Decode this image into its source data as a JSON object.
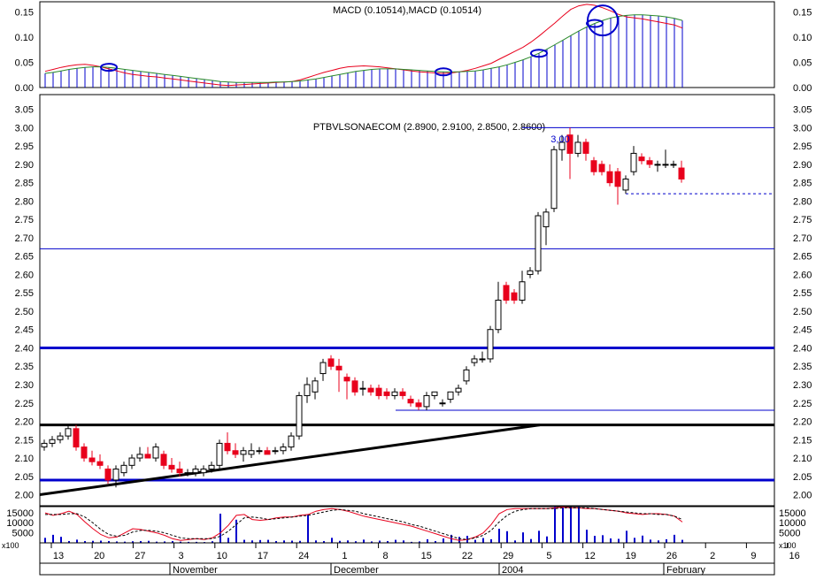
{
  "colors": {
    "background": "#ffffff",
    "up_candle_fill": "#ffffff",
    "down_candle_fill": "#e8001c",
    "blue": "#0000cc",
    "macd_line": "#e8001c",
    "signal_line": "#2a8a2a",
    "black": "#000000",
    "grid_line": "#000000"
  },
  "macd_panel": {
    "title": "MACD (0.10514),MACD (0.10514)",
    "y_ticks": [
      "0.15",
      "0.10",
      "0.05",
      "0.00"
    ]
  },
  "price_panel": {
    "title": "PTBVLSONAECOM (2.8900, 2.9100, 2.8500, 2.8600)",
    "y_ticks": [
      "3.05",
      "3.00",
      "2.95",
      "2.90",
      "2.85",
      "2.80",
      "2.75",
      "2.70",
      "2.65",
      "2.60",
      "2.55",
      "2.50",
      "2.45",
      "2.40",
      "2.35",
      "2.30",
      "2.25",
      "2.20",
      "2.15",
      "2.10",
      "2.05",
      "2.00"
    ],
    "annotation_label": "3,00"
  },
  "volume_panel": {
    "y_ticks": [
      "15000",
      "10000",
      "5000"
    ],
    "multiplier_label": "x100"
  },
  "x_axis": {
    "day_ticks": [
      "13",
      "20",
      "27",
      "3",
      "10",
      "17",
      "24",
      "1",
      "8",
      "15",
      "22",
      "29",
      "5",
      "12",
      "19",
      "26",
      "2",
      "9",
      "16"
    ],
    "month_labels": [
      "November",
      "December",
      "2004",
      "February"
    ]
  },
  "chart_data": {
    "type": "candlestick",
    "title": "PTBVLSONAECOM (2.8900, 2.9100, 2.8500, 2.8600)",
    "xlabel": "",
    "ylabel": "",
    "ylim": [
      1.97,
      3.09
    ],
    "candles": [
      {
        "o": 2.13,
        "h": 2.15,
        "l": 2.12,
        "c": 2.14
      },
      {
        "o": 2.14,
        "h": 2.16,
        "l": 2.13,
        "c": 2.15
      },
      {
        "o": 2.15,
        "h": 2.17,
        "l": 2.14,
        "c": 2.16
      },
      {
        "o": 2.16,
        "h": 2.19,
        "l": 2.15,
        "c": 2.18
      },
      {
        "o": 2.18,
        "h": 2.19,
        "l": 2.12,
        "c": 2.13
      },
      {
        "o": 2.13,
        "h": 2.14,
        "l": 2.09,
        "c": 2.1
      },
      {
        "o": 2.1,
        "h": 2.12,
        "l": 2.08,
        "c": 2.09
      },
      {
        "o": 2.09,
        "h": 2.11,
        "l": 2.07,
        "c": 2.08
      },
      {
        "o": 2.07,
        "h": 2.08,
        "l": 2.03,
        "c": 2.04
      },
      {
        "o": 2.04,
        "h": 2.08,
        "l": 2.02,
        "c": 2.07
      },
      {
        "o": 2.06,
        "h": 2.09,
        "l": 2.05,
        "c": 2.08
      },
      {
        "o": 2.08,
        "h": 2.11,
        "l": 2.07,
        "c": 2.1
      },
      {
        "o": 2.1,
        "h": 2.13,
        "l": 2.09,
        "c": 2.11
      },
      {
        "o": 2.11,
        "h": 2.13,
        "l": 2.1,
        "c": 2.1
      },
      {
        "o": 2.1,
        "h": 2.14,
        "l": 2.09,
        "c": 2.13
      },
      {
        "o": 2.11,
        "h": 2.12,
        "l": 2.07,
        "c": 2.08
      },
      {
        "o": 2.08,
        "h": 2.1,
        "l": 2.06,
        "c": 2.07
      },
      {
        "o": 2.07,
        "h": 2.09,
        "l": 2.05,
        "c": 2.06
      },
      {
        "o": 2.06,
        "h": 2.07,
        "l": 2.05,
        "c": 2.06
      },
      {
        "o": 2.06,
        "h": 2.08,
        "l": 2.05,
        "c": 2.07
      },
      {
        "o": 2.06,
        "h": 2.08,
        "l": 2.05,
        "c": 2.07
      },
      {
        "o": 2.07,
        "h": 2.09,
        "l": 2.06,
        "c": 2.08
      },
      {
        "o": 2.08,
        "h": 2.15,
        "l": 2.07,
        "c": 2.14
      },
      {
        "o": 2.14,
        "h": 2.17,
        "l": 2.11,
        "c": 2.12
      },
      {
        "o": 2.12,
        "h": 2.14,
        "l": 2.1,
        "c": 2.11
      },
      {
        "o": 2.11,
        "h": 2.13,
        "l": 2.09,
        "c": 2.12
      },
      {
        "o": 2.11,
        "h": 2.14,
        "l": 2.1,
        "c": 2.12
      },
      {
        "o": 2.12,
        "h": 2.13,
        "l": 2.11,
        "c": 2.12
      },
      {
        "o": 2.12,
        "h": 2.13,
        "l": 2.11,
        "c": 2.11
      },
      {
        "o": 2.12,
        "h": 2.13,
        "l": 2.11,
        "c": 2.12
      },
      {
        "o": 2.12,
        "h": 2.14,
        "l": 2.11,
        "c": 2.13
      },
      {
        "o": 2.13,
        "h": 2.17,
        "l": 2.12,
        "c": 2.16
      },
      {
        "o": 2.16,
        "h": 2.28,
        "l": 2.15,
        "c": 2.27
      },
      {
        "o": 2.27,
        "h": 2.32,
        "l": 2.25,
        "c": 2.3
      },
      {
        "o": 2.28,
        "h": 2.32,
        "l": 2.26,
        "c": 2.31
      },
      {
        "o": 2.33,
        "h": 2.37,
        "l": 2.31,
        "c": 2.36
      },
      {
        "o": 2.37,
        "h": 2.38,
        "l": 2.34,
        "c": 2.35
      },
      {
        "o": 2.35,
        "h": 2.37,
        "l": 2.28,
        "c": 2.34
      },
      {
        "o": 2.32,
        "h": 2.33,
        "l": 2.26,
        "c": 2.31
      },
      {
        "o": 2.31,
        "h": 2.32,
        "l": 2.27,
        "c": 2.28
      },
      {
        "o": 2.29,
        "h": 2.31,
        "l": 2.27,
        "c": 2.29
      },
      {
        "o": 2.29,
        "h": 2.3,
        "l": 2.27,
        "c": 2.28
      },
      {
        "o": 2.29,
        "h": 2.3,
        "l": 2.26,
        "c": 2.27
      },
      {
        "o": 2.28,
        "h": 2.29,
        "l": 2.26,
        "c": 2.27
      },
      {
        "o": 2.27,
        "h": 2.29,
        "l": 2.26,
        "c": 2.28
      },
      {
        "o": 2.28,
        "h": 2.29,
        "l": 2.26,
        "c": 2.27
      },
      {
        "o": 2.26,
        "h": 2.27,
        "l": 2.24,
        "c": 2.25
      },
      {
        "o": 2.25,
        "h": 2.26,
        "l": 2.23,
        "c": 2.24
      },
      {
        "o": 2.24,
        "h": 2.28,
        "l": 2.23,
        "c": 2.27
      },
      {
        "o": 2.27,
        "h": 2.28,
        "l": 2.26,
        "c": 2.28
      },
      {
        "o": 2.25,
        "h": 2.26,
        "l": 2.24,
        "c": 2.25
      },
      {
        "o": 2.26,
        "h": 2.28,
        "l": 2.25,
        "c": 2.28
      },
      {
        "o": 2.28,
        "h": 2.3,
        "l": 2.27,
        "c": 2.29
      },
      {
        "o": 2.31,
        "h": 2.35,
        "l": 2.3,
        "c": 2.34
      },
      {
        "o": 2.36,
        "h": 2.38,
        "l": 2.35,
        "c": 2.37
      },
      {
        "o": 2.37,
        "h": 2.39,
        "l": 2.36,
        "c": 2.37
      },
      {
        "o": 2.37,
        "h": 2.46,
        "l": 2.36,
        "c": 2.45
      },
      {
        "o": 2.45,
        "h": 2.58,
        "l": 2.44,
        "c": 2.53
      },
      {
        "o": 2.57,
        "h": 2.58,
        "l": 2.52,
        "c": 2.53
      },
      {
        "o": 2.55,
        "h": 2.56,
        "l": 2.52,
        "c": 2.53
      },
      {
        "o": 2.53,
        "h": 2.61,
        "l": 2.52,
        "c": 2.58
      },
      {
        "o": 2.6,
        "h": 2.62,
        "l": 2.59,
        "c": 2.61
      },
      {
        "o": 2.61,
        "h": 2.77,
        "l": 2.6,
        "c": 2.76
      },
      {
        "o": 2.73,
        "h": 2.78,
        "l": 2.68,
        "c": 2.77
      },
      {
        "o": 2.78,
        "h": 2.95,
        "l": 2.77,
        "c": 2.94
      },
      {
        "o": 2.94,
        "h": 2.98,
        "l": 2.91,
        "c": 2.96
      },
      {
        "o": 2.98,
        "h": 3.0,
        "l": 2.86,
        "c": 2.93
      },
      {
        "o": 2.93,
        "h": 2.98,
        "l": 2.92,
        "c": 2.96
      },
      {
        "o": 2.96,
        "h": 2.97,
        "l": 2.91,
        "c": 2.93
      },
      {
        "o": 2.91,
        "h": 2.92,
        "l": 2.87,
        "c": 2.88
      },
      {
        "o": 2.9,
        "h": 2.91,
        "l": 2.87,
        "c": 2.88
      },
      {
        "o": 2.88,
        "h": 2.9,
        "l": 2.84,
        "c": 2.85
      },
      {
        "o": 2.88,
        "h": 2.89,
        "l": 2.79,
        "c": 2.84
      },
      {
        "o": 2.83,
        "h": 2.87,
        "l": 2.82,
        "c": 2.86
      },
      {
        "o": 2.88,
        "h": 2.95,
        "l": 2.87,
        "c": 2.93
      },
      {
        "o": 2.92,
        "h": 2.93,
        "l": 2.9,
        "c": 2.91
      },
      {
        "o": 2.91,
        "h": 2.92,
        "l": 2.89,
        "c": 2.9
      },
      {
        "o": 2.9,
        "h": 2.91,
        "l": 2.88,
        "c": 2.9
      },
      {
        "o": 2.9,
        "h": 2.94,
        "l": 2.89,
        "c": 2.9
      },
      {
        "o": 2.9,
        "h": 2.91,
        "l": 2.89,
        "c": 2.9
      },
      {
        "o": 2.89,
        "h": 2.91,
        "l": 2.85,
        "c": 2.86
      }
    ],
    "horizontal_lines": [
      {
        "y": 3.0,
        "style": "thin-blue"
      },
      {
        "y": 2.67,
        "style": "thin-blue"
      },
      {
        "y": 2.4,
        "style": "thick-blue"
      },
      {
        "y": 2.23,
        "style": "thin-blue"
      },
      {
        "y": 2.19,
        "style": "thick-black"
      },
      {
        "y": 2.04,
        "style": "thick-blue"
      },
      {
        "y": 2.82,
        "style": "dashed-blue"
      }
    ],
    "trendline": {
      "from": {
        "index": 0,
        "y": 2.0
      },
      "to": {
        "index": 62,
        "y": 2.19
      }
    },
    "macd": {
      "ylim": [
        0,
        0.17
      ],
      "macd_line": [
        0.032,
        0.036,
        0.04,
        0.043,
        0.045,
        0.046,
        0.044,
        0.041,
        0.037,
        0.033,
        0.029,
        0.026,
        0.024,
        0.022,
        0.021,
        0.019,
        0.017,
        0.015,
        0.013,
        0.011,
        0.009,
        0.007,
        0.005,
        0.004,
        0.005,
        0.006,
        0.007,
        0.008,
        0.009,
        0.01,
        0.011,
        0.012,
        0.015,
        0.02,
        0.025,
        0.03,
        0.034,
        0.038,
        0.041,
        0.042,
        0.043,
        0.042,
        0.041,
        0.039,
        0.037,
        0.035,
        0.033,
        0.031,
        0.03,
        0.029,
        0.028,
        0.029,
        0.031,
        0.034,
        0.038,
        0.043,
        0.048,
        0.056,
        0.064,
        0.072,
        0.08,
        0.09,
        0.102,
        0.115,
        0.128,
        0.142,
        0.155,
        0.162,
        0.165,
        0.163,
        0.158,
        0.152,
        0.145,
        0.14,
        0.138,
        0.136,
        0.133,
        0.13,
        0.127,
        0.124,
        0.118
      ],
      "signal_line": [
        0.028,
        0.03,
        0.033,
        0.036,
        0.038,
        0.04,
        0.041,
        0.041,
        0.04,
        0.038,
        0.036,
        0.034,
        0.032,
        0.03,
        0.028,
        0.026,
        0.024,
        0.022,
        0.02,
        0.018,
        0.016,
        0.014,
        0.012,
        0.011,
        0.01,
        0.01,
        0.01,
        0.01,
        0.01,
        0.011,
        0.011,
        0.012,
        0.013,
        0.015,
        0.017,
        0.02,
        0.023,
        0.026,
        0.029,
        0.032,
        0.034,
        0.036,
        0.037,
        0.037,
        0.037,
        0.036,
        0.035,
        0.034,
        0.033,
        0.032,
        0.031,
        0.031,
        0.031,
        0.032,
        0.033,
        0.035,
        0.038,
        0.041,
        0.045,
        0.05,
        0.055,
        0.061,
        0.068,
        0.076,
        0.085,
        0.094,
        0.103,
        0.112,
        0.12,
        0.127,
        0.133,
        0.138,
        0.141,
        0.143,
        0.144,
        0.144,
        0.143,
        0.142,
        0.14,
        0.137,
        0.133
      ],
      "histogram": [
        0.028,
        0.03,
        0.033,
        0.036,
        0.038,
        0.04,
        0.041,
        0.041,
        0.04,
        0.038,
        0.036,
        0.034,
        0.032,
        0.03,
        0.028,
        0.026,
        0.024,
        0.022,
        0.02,
        0.018,
        0.016,
        0.014,
        0.012,
        0.011,
        0.01,
        0.01,
        0.01,
        0.01,
        0.01,
        0.011,
        0.011,
        0.012,
        0.013,
        0.015,
        0.017,
        0.02,
        0.023,
        0.026,
        0.029,
        0.032,
        0.034,
        0.036,
        0.037,
        0.037,
        0.037,
        0.036,
        0.035,
        0.034,
        0.033,
        0.032,
        0.031,
        0.031,
        0.031,
        0.032,
        0.033,
        0.035,
        0.038,
        0.041,
        0.045,
        0.05,
        0.055,
        0.061,
        0.068,
        0.076,
        0.085,
        0.094,
        0.103,
        0.112,
        0.12,
        0.127,
        0.133,
        0.138,
        0.141,
        0.143,
        0.144,
        0.144,
        0.143,
        0.142,
        0.14,
        0.137,
        0.133
      ]
    },
    "volume": {
      "unit": "x100",
      "ylim": [
        0,
        18000
      ],
      "bars": [
        2500,
        4000,
        3000,
        900,
        1600,
        900,
        1000,
        1100,
        900,
        700,
        600,
        800,
        900,
        1000,
        600,
        700,
        900,
        600,
        500,
        500,
        400,
        800,
        14500,
        2500,
        11500,
        1500,
        1200,
        1400,
        1500,
        900,
        1200,
        1100,
        1000,
        14000,
        1200,
        900,
        2500,
        1000,
        1200,
        800,
        1600,
        700,
        1100,
        900,
        1500,
        1200,
        500,
        700,
        1800,
        900,
        2200,
        4000,
        3000,
        3500,
        1500,
        2400,
        1800,
        7000,
        5800,
        1200,
        5200,
        1900,
        6000,
        3200,
        18000,
        18000,
        17800,
        18000,
        6500,
        3500,
        3800,
        2200,
        2000,
        6000,
        2500,
        3600,
        1600,
        1200,
        1800,
        4000,
        1500
      ],
      "oscillator_solid": [
        0.36,
        0.33,
        0.35,
        0.38,
        0.34,
        0.25,
        0.17,
        0.1,
        0.06,
        0.07,
        0.12,
        0.17,
        0.16,
        0.14,
        0.12,
        0.09,
        0.05,
        0.03,
        0.04,
        0.05,
        0.04,
        0.06,
        0.12,
        0.21,
        0.33,
        0.34,
        0.28,
        0.27,
        0.28,
        0.3,
        0.31,
        0.31,
        0.33,
        0.34,
        0.38,
        0.4,
        0.41,
        0.4,
        0.38,
        0.35,
        0.32,
        0.3,
        0.28,
        0.26,
        0.24,
        0.22,
        0.2,
        0.17,
        0.14,
        0.11,
        0.08,
        0.05,
        0.03,
        0.04,
        0.07,
        0.12,
        0.22,
        0.35,
        0.4,
        0.41,
        0.41,
        0.41,
        0.41,
        0.41,
        0.42,
        0.43,
        0.42,
        0.42,
        0.41,
        0.41,
        0.4,
        0.39,
        0.38,
        0.36,
        0.35,
        0.34,
        0.35,
        0.35,
        0.34,
        0.32,
        0.25
      ],
      "oscillator_dashed": [
        0.34,
        0.34,
        0.34,
        0.35,
        0.35,
        0.31,
        0.24,
        0.16,
        0.1,
        0.08,
        0.09,
        0.13,
        0.15,
        0.15,
        0.14,
        0.12,
        0.09,
        0.06,
        0.05,
        0.05,
        0.05,
        0.05,
        0.08,
        0.14,
        0.22,
        0.3,
        0.31,
        0.3,
        0.28,
        0.29,
        0.3,
        0.31,
        0.32,
        0.33,
        0.35,
        0.37,
        0.39,
        0.4,
        0.39,
        0.38,
        0.35,
        0.33,
        0.31,
        0.29,
        0.27,
        0.25,
        0.22,
        0.2,
        0.17,
        0.14,
        0.11,
        0.08,
        0.05,
        0.04,
        0.06,
        0.09,
        0.15,
        0.25,
        0.33,
        0.38,
        0.4,
        0.41,
        0.41,
        0.41,
        0.41,
        0.42,
        0.42,
        0.42,
        0.42,
        0.41,
        0.4,
        0.39,
        0.38,
        0.37,
        0.36,
        0.35,
        0.35,
        0.34,
        0.34,
        0.32,
        0.28
      ]
    },
    "macd_highlights": [
      8,
      50,
      69,
      62
    ],
    "macd_big_circle_index": 70
  }
}
